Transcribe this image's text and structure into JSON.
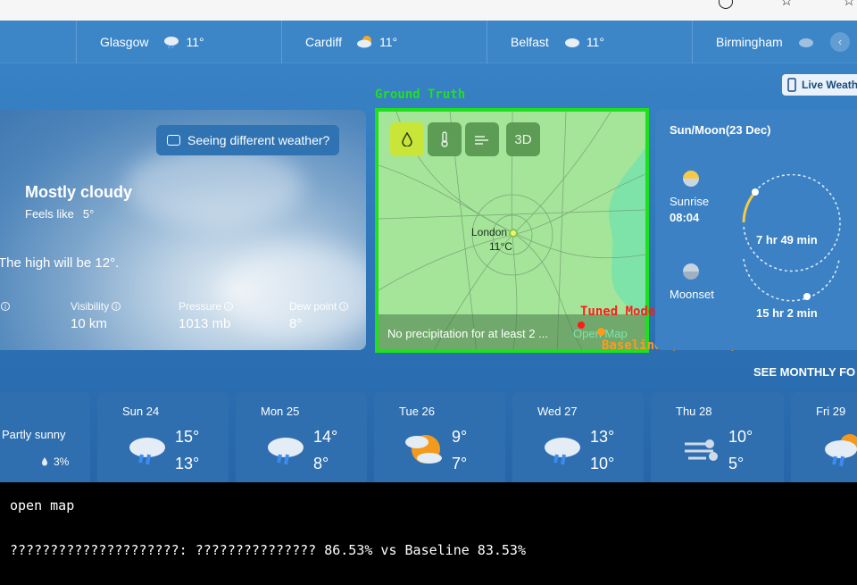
{
  "cities": [
    {
      "name": "Glasgow",
      "temp": "11°",
      "icon": "cloud-rain-icon"
    },
    {
      "name": "Cardiff",
      "temp": "11°",
      "icon": "partly-sunny-icon"
    },
    {
      "name": "Belfast",
      "temp": "11°",
      "icon": "cloud-icon"
    },
    {
      "name": "Birmingham",
      "temp": "",
      "icon": "cloud-icon"
    }
  ],
  "live_button": "Live Weath",
  "current": {
    "seeing_button": "Seeing different weather?",
    "condition": "Mostly cloudy",
    "feels_label": "Feels like",
    "feels_value": "5°",
    "high_text": "The high will be 12°.",
    "stats": [
      {
        "label": "Visibility",
        "value": "10 km"
      },
      {
        "label": "Pressure",
        "value": "1013 mb"
      },
      {
        "label": "Dew point",
        "value": "8°"
      }
    ]
  },
  "map": {
    "tools": [
      "precipitation-icon",
      "temperature-icon",
      "wind-icon"
    ],
    "tool_3d": "3D",
    "city": "London",
    "temp": "11°C",
    "footer_text": "No precipitation for at least 2 ...",
    "open_link": "Open Map"
  },
  "annotations": {
    "ground_truth": "Ground Truth",
    "tuned": "Tuned Model (Correct)",
    "baseline": "Baseline (Correct)"
  },
  "sunmoon": {
    "title": "Sun/Moon(23 Dec)",
    "sunrise_label": "Sunrise",
    "sunrise_time": "08:04",
    "day_length": "7 hr 49 min",
    "moonset_label": "Moonset",
    "moonset_time": "",
    "moon_duration": "15 hr 2 min"
  },
  "see_monthly": "SEE MONTHLY FO",
  "forecast": [
    {
      "day": "Partly sunny",
      "hi": "",
      "lo": "",
      "precip": "3%"
    },
    {
      "day": "Sun 24",
      "hi": "15°",
      "lo": "13°",
      "icon": "cloud-rain-icon"
    },
    {
      "day": "Mon 25",
      "hi": "14°",
      "lo": "8°",
      "icon": "cloud-rain-icon"
    },
    {
      "day": "Tue 26",
      "hi": "9°",
      "lo": "7°",
      "icon": "partly-sunny-icon"
    },
    {
      "day": "Wed 27",
      "hi": "13°",
      "lo": "10°",
      "icon": "cloud-rain-icon"
    },
    {
      "day": "Thu 28",
      "hi": "10°",
      "lo": "5°",
      "icon": "wind-icon"
    },
    {
      "day": "Fri 29",
      "hi": "",
      "lo": "",
      "icon": "partly-sunny-rain-icon"
    }
  ],
  "caption": {
    "instruction": "open map",
    "result": "?????????????????????: ??????????????? 86.53% vs Baseline 83.53%"
  }
}
